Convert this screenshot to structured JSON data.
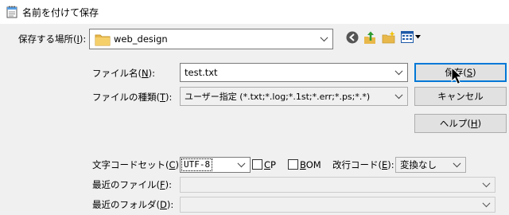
{
  "window": {
    "title": "名前を付けて保存",
    "title_icon": "notepad-icon"
  },
  "location": {
    "label": "保存する場所(",
    "label_key": "I",
    "label_tail": "):",
    "folder": "web_design",
    "folder_icon": "folder-icon"
  },
  "toolbar": {
    "icons": [
      "back-icon",
      "up-folder-icon",
      "new-folder-icon",
      "view-menu-icon"
    ]
  },
  "filename": {
    "label": "ファイル名(",
    "label_key": "N",
    "label_tail": "):",
    "value": "test.txt"
  },
  "filetype": {
    "label": "ファイルの種類(",
    "label_key": "T",
    "label_tail": "):",
    "value": "ユーザー指定 (*.txt;*.log;*.1st;*.err;*.ps;*.*)"
  },
  "buttons": {
    "save": "保存(",
    "save_key": "S",
    "save_tail": ")",
    "cancel": "キャンセル",
    "help": "ヘルプ(",
    "help_key": "H",
    "help_tail": ")"
  },
  "encoding": {
    "label": "文字コードセット(",
    "label_key": "C",
    "label_tail": "):",
    "value": "UTF-8",
    "cp_label_key": "C",
    "cp_label_tail": "P",
    "bom_label_key": "B",
    "bom_label_tail": "OM",
    "newline_label": "改行コード(",
    "newline_key": "E",
    "newline_tail": "):",
    "newline_value": "変換なし"
  },
  "recent_file": {
    "label": "最近のファイル(",
    "label_key": "F",
    "label_tail": "):",
    "value": ""
  },
  "recent_folder": {
    "label": "最近のフォルダ(",
    "label_key": "D",
    "label_tail": "):",
    "value": ""
  }
}
